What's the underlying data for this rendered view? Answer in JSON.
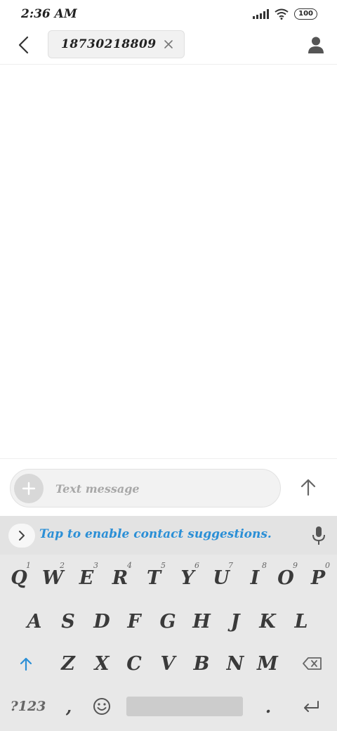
{
  "status_bar": {
    "time": "2:36 AM",
    "battery": "100",
    "icons": [
      "signal-icon",
      "wifi-icon",
      "battery-icon"
    ]
  },
  "header": {
    "back_icon": "back-arrow-icon",
    "recipient": "18730218809",
    "chip_close_icon": "close-icon",
    "contact_icon": "person-icon"
  },
  "compose": {
    "add_icon": "plus-icon",
    "placeholder": "Text message",
    "value": "",
    "send_icon": "arrow-up-icon"
  },
  "keyboard": {
    "suggestion_text": "Tap to enable contact suggestions.",
    "expand_icon": "chevron-right-icon",
    "mic_icon": "microphone-icon",
    "row1": [
      {
        "label": "Q",
        "hint": "1"
      },
      {
        "label": "W",
        "hint": "2"
      },
      {
        "label": "E",
        "hint": "3"
      },
      {
        "label": "R",
        "hint": "4"
      },
      {
        "label": "T",
        "hint": "5"
      },
      {
        "label": "Y",
        "hint": "6"
      },
      {
        "label": "U",
        "hint": "7"
      },
      {
        "label": "I",
        "hint": "8"
      },
      {
        "label": "O",
        "hint": "9"
      },
      {
        "label": "P",
        "hint": "0"
      }
    ],
    "row2": [
      "A",
      "S",
      "D",
      "F",
      "G",
      "H",
      "J",
      "K",
      "L"
    ],
    "row3": [
      "Z",
      "X",
      "C",
      "V",
      "B",
      "N",
      "M"
    ],
    "shift_icon": "shift-arrow-icon",
    "backspace_icon": "backspace-icon",
    "symbols_label": "?123",
    "comma_label": ",",
    "emoji_icon": "emoji-icon",
    "period_label": ".",
    "enter_icon": "enter-icon",
    "accent_color": "#2b8fd6"
  }
}
